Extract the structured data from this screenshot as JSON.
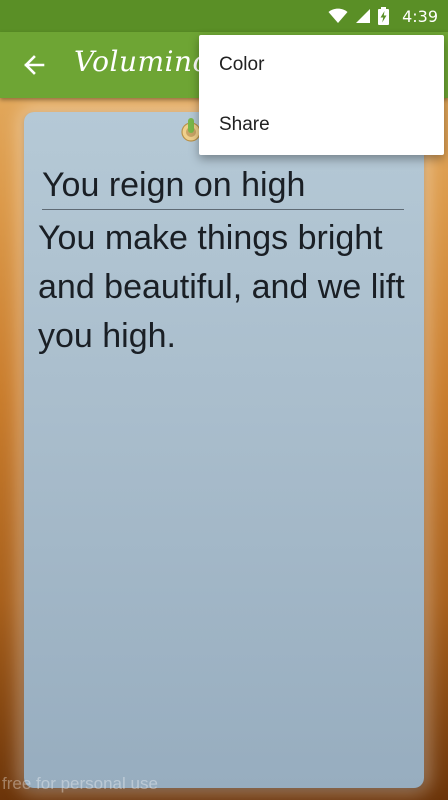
{
  "status_bar": {
    "time": "4:39",
    "icons": [
      "wifi-icon",
      "cellular-signal-icon",
      "battery-charging-icon"
    ]
  },
  "app_bar": {
    "back_icon": "arrow-back-icon",
    "title": "Voluminotes"
  },
  "note": {
    "title": "You reign on high",
    "body": "You make things bright and beautiful, and we lift you high.",
    "color": "#b2c6d4"
  },
  "overflow_menu": {
    "items": [
      {
        "label": "Color"
      },
      {
        "label": "Share"
      }
    ]
  },
  "watermark": "free for personal use",
  "colors": {
    "status_bar": "#5a8f26",
    "app_bar": "#6ea534",
    "menu_bg": "#ffffff"
  }
}
